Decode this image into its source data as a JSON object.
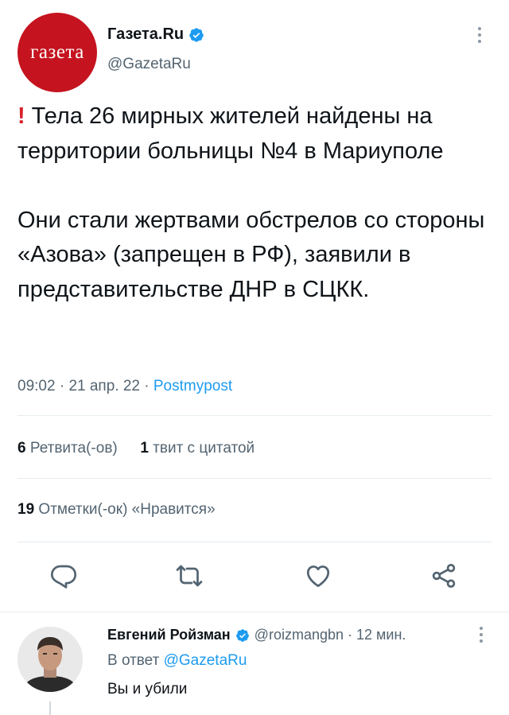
{
  "author": {
    "avatar_text": "газета",
    "name": "Газета.Ru",
    "handle": "@GazetaRu"
  },
  "tweet": {
    "text_para1": "Тела 26 мирных жителей найдены на территории больницы №4 в Мариуполе",
    "text_para2": "Они стали жертвами обстрелов со стороны «Азова» (запрещен в РФ), заявили в представительстве ДНР в СЦКК.",
    "time": "09:02",
    "date": "21 апр. 22",
    "source": "Postmypost"
  },
  "stats": {
    "retweets_count": "6",
    "retweets_label": "Ретвита(-ов)",
    "quotes_count": "1",
    "quotes_label": "твит с цитатой",
    "likes_count": "19",
    "likes_label": "Отметки(-ок) «Нравится»"
  },
  "actions": [
    "reply-icon",
    "retweet-icon",
    "like-icon",
    "share-icon"
  ],
  "reply": {
    "name": "Евгений Ройзман",
    "handle": "@roizmangbn",
    "time": "12 мин.",
    "reply_to_prefix": "В ответ",
    "reply_to_mention": "@GazetaRu",
    "text": "Вы и убили"
  },
  "colors": {
    "accent": "#1d9bf0",
    "brand_red": "#c5141f",
    "secondary_text": "#536471"
  }
}
